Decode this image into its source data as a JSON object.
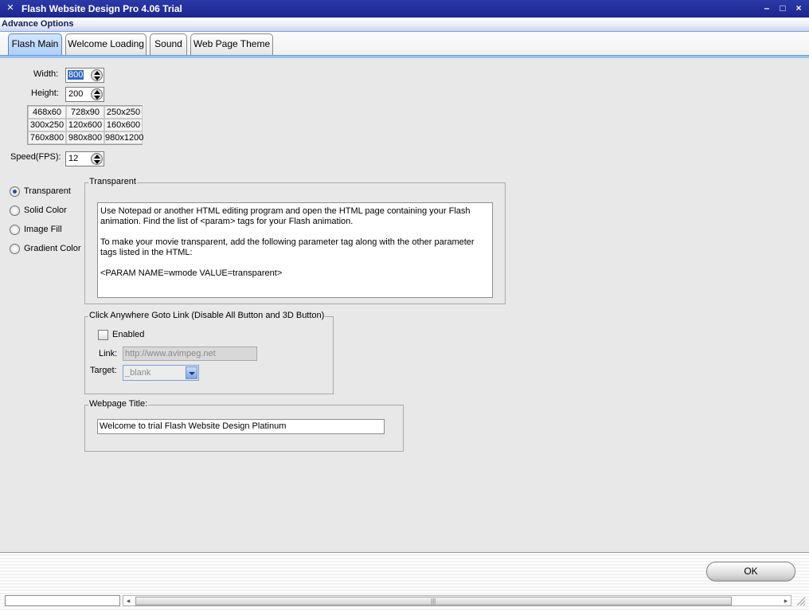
{
  "window": {
    "title": "Flash Website Design Pro 4.06 Trial",
    "subtitle": "Advance Options",
    "minimize": "–",
    "maximize": "□",
    "close": "×"
  },
  "tabs": [
    {
      "label": "Flash Main",
      "active": true
    },
    {
      "label": "Welcome Loading",
      "active": false
    },
    {
      "label": "Sound",
      "active": false
    },
    {
      "label": "Web Page Theme",
      "active": false
    }
  ],
  "dimensions": {
    "width_label": "Width:",
    "width_value": "800",
    "height_label": "Height:",
    "height_value": "200",
    "presets": [
      [
        "468x60",
        "728x90",
        "250x250"
      ],
      [
        "300x250",
        "120x600",
        "160x600"
      ],
      [
        "760x800",
        "980x800",
        "980x1200"
      ]
    ],
    "speed_label": "Speed(FPS):",
    "speed_value": "12"
  },
  "background": {
    "options": [
      {
        "label": "Transparent",
        "selected": true
      },
      {
        "label": "Solid Color",
        "selected": false
      },
      {
        "label": "Image Fill",
        "selected": false
      },
      {
        "label": "Gradient Color",
        "selected": false
      }
    ]
  },
  "transparent_group": {
    "legend": "Transparent",
    "paragraph1": "Use Notepad or another HTML editing program and open the HTML page containing your Flash animation. Find the list of <param> tags for your Flash animation.",
    "paragraph2": "To make your movie transparent, add the following parameter tag along with the other parameter tags listed in the HTML:",
    "code": " <PARAM NAME=wmode VALUE=transparent>"
  },
  "goto_group": {
    "legend": "Click Anywhere Goto Link (Disable All Button and 3D Button)",
    "enabled_label": "Enabled",
    "enabled_checked": false,
    "link_label": "Link:",
    "link_value": "http://www.avimpeg.net",
    "target_label": "Target:",
    "target_value": "_blank"
  },
  "title_group": {
    "legend": "Webpage Title:",
    "value": "Welcome to trial Flash Website Design Platinum"
  },
  "footer": {
    "ok_label": "OK"
  },
  "icons": {
    "app": "app-icon",
    "spin": "spin-arrows-icon",
    "dropdown": "chevron-down-icon"
  }
}
